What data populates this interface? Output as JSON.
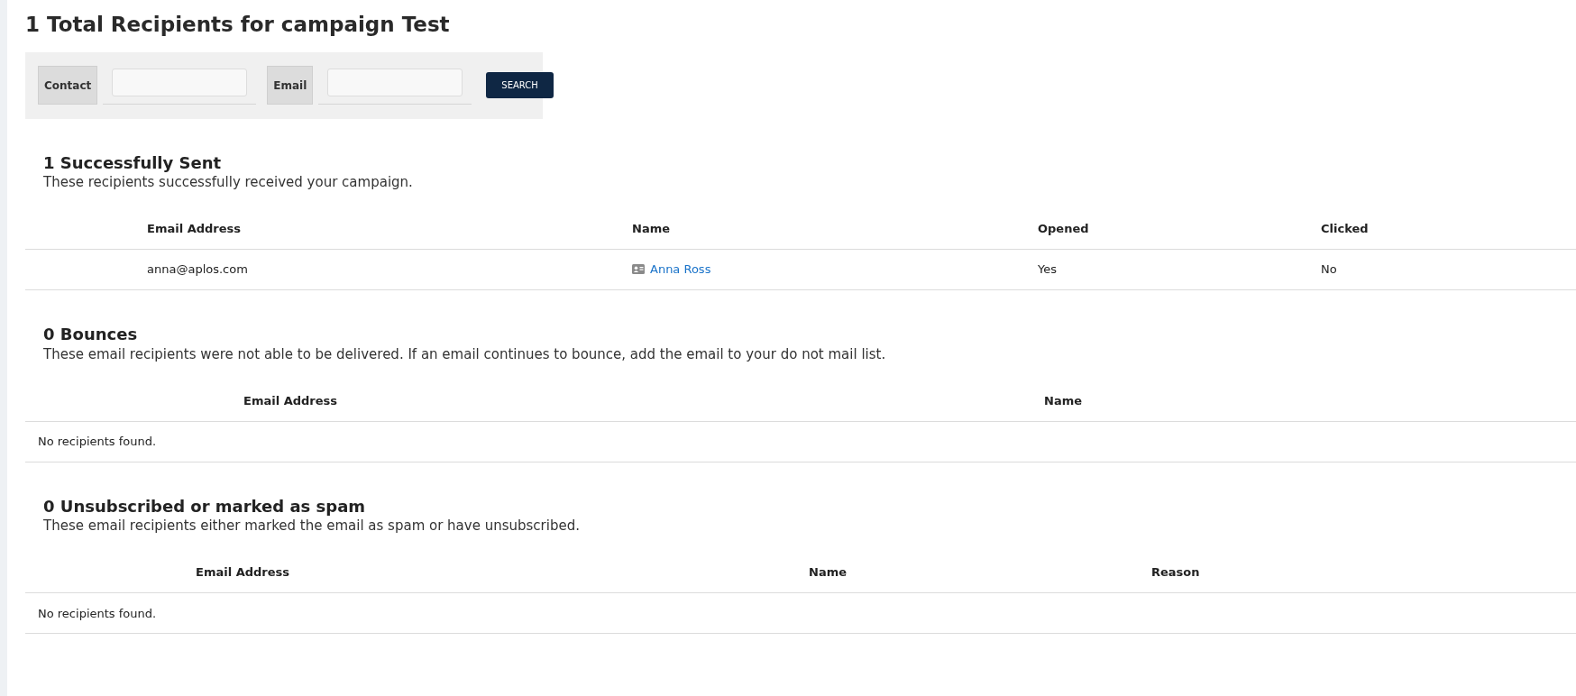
{
  "title": "1 Total Recipients for campaign Test",
  "search": {
    "fields": [
      {
        "label": "Contact"
      },
      {
        "label": "Email"
      }
    ],
    "button": "SEARCH"
  },
  "sections": [
    {
      "heading": "1 Successfully Sent",
      "description": "These recipients successfully received your campaign.",
      "columns": [
        "Email Address",
        "Name",
        "Opened",
        "Clicked"
      ],
      "rows": [
        {
          "cells": [
            {
              "kind": "text",
              "text": "anna@aplos.com"
            },
            {
              "kind": "contact",
              "text": "Anna Ross"
            },
            {
              "kind": "text",
              "text": "Yes"
            },
            {
              "kind": "text",
              "text": "No"
            }
          ]
        }
      ]
    },
    {
      "heading": "0 Bounces",
      "description": "These email recipients were not able to be delivered. If an email continues to bounce, add the email to your do not mail list.",
      "columns": [
        "Email Address",
        "Name"
      ],
      "empty_message": "No recipients found."
    },
    {
      "heading": "0 Unsubscribed or marked as spam",
      "description": "These email recipients either marked the email as spam or have unsubscribed.",
      "columns": [
        "Email Address",
        "Name",
        "Reason"
      ],
      "empty_message": "No recipients found."
    }
  ]
}
